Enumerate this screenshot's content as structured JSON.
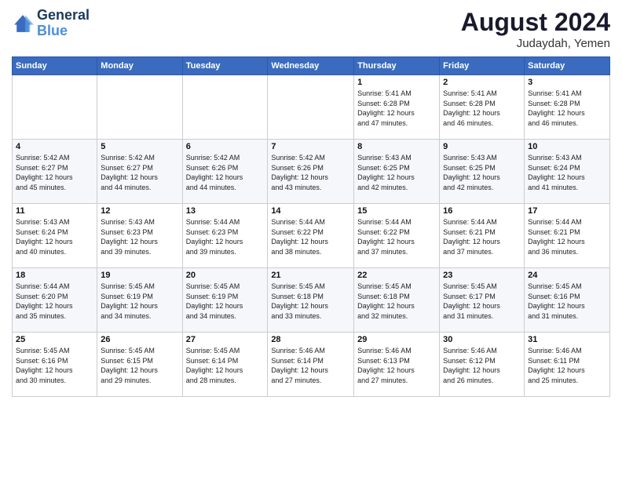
{
  "header": {
    "logo_line1": "General",
    "logo_line2": "Blue",
    "month_year": "August 2024",
    "location": "Judaydah, Yemen"
  },
  "weekdays": [
    "Sunday",
    "Monday",
    "Tuesday",
    "Wednesday",
    "Thursday",
    "Friday",
    "Saturday"
  ],
  "weeks": [
    [
      {
        "day": "",
        "info": ""
      },
      {
        "day": "",
        "info": ""
      },
      {
        "day": "",
        "info": ""
      },
      {
        "day": "",
        "info": ""
      },
      {
        "day": "1",
        "info": "Sunrise: 5:41 AM\nSunset: 6:28 PM\nDaylight: 12 hours\nand 47 minutes."
      },
      {
        "day": "2",
        "info": "Sunrise: 5:41 AM\nSunset: 6:28 PM\nDaylight: 12 hours\nand 46 minutes."
      },
      {
        "day": "3",
        "info": "Sunrise: 5:41 AM\nSunset: 6:28 PM\nDaylight: 12 hours\nand 46 minutes."
      }
    ],
    [
      {
        "day": "4",
        "info": "Sunrise: 5:42 AM\nSunset: 6:27 PM\nDaylight: 12 hours\nand 45 minutes."
      },
      {
        "day": "5",
        "info": "Sunrise: 5:42 AM\nSunset: 6:27 PM\nDaylight: 12 hours\nand 44 minutes."
      },
      {
        "day": "6",
        "info": "Sunrise: 5:42 AM\nSunset: 6:26 PM\nDaylight: 12 hours\nand 44 minutes."
      },
      {
        "day": "7",
        "info": "Sunrise: 5:42 AM\nSunset: 6:26 PM\nDaylight: 12 hours\nand 43 minutes."
      },
      {
        "day": "8",
        "info": "Sunrise: 5:43 AM\nSunset: 6:25 PM\nDaylight: 12 hours\nand 42 minutes."
      },
      {
        "day": "9",
        "info": "Sunrise: 5:43 AM\nSunset: 6:25 PM\nDaylight: 12 hours\nand 42 minutes."
      },
      {
        "day": "10",
        "info": "Sunrise: 5:43 AM\nSunset: 6:24 PM\nDaylight: 12 hours\nand 41 minutes."
      }
    ],
    [
      {
        "day": "11",
        "info": "Sunrise: 5:43 AM\nSunset: 6:24 PM\nDaylight: 12 hours\nand 40 minutes."
      },
      {
        "day": "12",
        "info": "Sunrise: 5:43 AM\nSunset: 6:23 PM\nDaylight: 12 hours\nand 39 minutes."
      },
      {
        "day": "13",
        "info": "Sunrise: 5:44 AM\nSunset: 6:23 PM\nDaylight: 12 hours\nand 39 minutes."
      },
      {
        "day": "14",
        "info": "Sunrise: 5:44 AM\nSunset: 6:22 PM\nDaylight: 12 hours\nand 38 minutes."
      },
      {
        "day": "15",
        "info": "Sunrise: 5:44 AM\nSunset: 6:22 PM\nDaylight: 12 hours\nand 37 minutes."
      },
      {
        "day": "16",
        "info": "Sunrise: 5:44 AM\nSunset: 6:21 PM\nDaylight: 12 hours\nand 37 minutes."
      },
      {
        "day": "17",
        "info": "Sunrise: 5:44 AM\nSunset: 6:21 PM\nDaylight: 12 hours\nand 36 minutes."
      }
    ],
    [
      {
        "day": "18",
        "info": "Sunrise: 5:44 AM\nSunset: 6:20 PM\nDaylight: 12 hours\nand 35 minutes."
      },
      {
        "day": "19",
        "info": "Sunrise: 5:45 AM\nSunset: 6:19 PM\nDaylight: 12 hours\nand 34 minutes."
      },
      {
        "day": "20",
        "info": "Sunrise: 5:45 AM\nSunset: 6:19 PM\nDaylight: 12 hours\nand 34 minutes."
      },
      {
        "day": "21",
        "info": "Sunrise: 5:45 AM\nSunset: 6:18 PM\nDaylight: 12 hours\nand 33 minutes."
      },
      {
        "day": "22",
        "info": "Sunrise: 5:45 AM\nSunset: 6:18 PM\nDaylight: 12 hours\nand 32 minutes."
      },
      {
        "day": "23",
        "info": "Sunrise: 5:45 AM\nSunset: 6:17 PM\nDaylight: 12 hours\nand 31 minutes."
      },
      {
        "day": "24",
        "info": "Sunrise: 5:45 AM\nSunset: 6:16 PM\nDaylight: 12 hours\nand 31 minutes."
      }
    ],
    [
      {
        "day": "25",
        "info": "Sunrise: 5:45 AM\nSunset: 6:16 PM\nDaylight: 12 hours\nand 30 minutes."
      },
      {
        "day": "26",
        "info": "Sunrise: 5:45 AM\nSunset: 6:15 PM\nDaylight: 12 hours\nand 29 minutes."
      },
      {
        "day": "27",
        "info": "Sunrise: 5:45 AM\nSunset: 6:14 PM\nDaylight: 12 hours\nand 28 minutes."
      },
      {
        "day": "28",
        "info": "Sunrise: 5:46 AM\nSunset: 6:14 PM\nDaylight: 12 hours\nand 27 minutes."
      },
      {
        "day": "29",
        "info": "Sunrise: 5:46 AM\nSunset: 6:13 PM\nDaylight: 12 hours\nand 27 minutes."
      },
      {
        "day": "30",
        "info": "Sunrise: 5:46 AM\nSunset: 6:12 PM\nDaylight: 12 hours\nand 26 minutes."
      },
      {
        "day": "31",
        "info": "Sunrise: 5:46 AM\nSunset: 6:11 PM\nDaylight: 12 hours\nand 25 minutes."
      }
    ]
  ]
}
